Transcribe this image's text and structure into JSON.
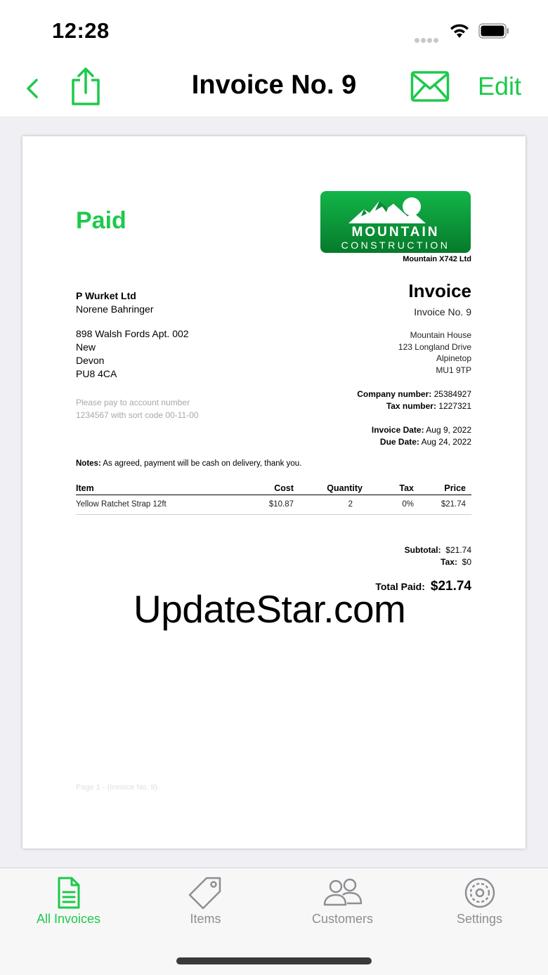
{
  "status": {
    "time": "12:28"
  },
  "nav": {
    "title": "Invoice No. 9",
    "edit_label": "Edit"
  },
  "colors": {
    "accent": "#1ec94c",
    "logo_green": "#0a9a3a",
    "tab_inactive": "#8e8e93"
  },
  "invoice": {
    "status": "Paid",
    "logo_line1": "MOUNTAIN",
    "logo_line2": "CONSTRUCTION",
    "company": "Mountain X742 Ltd",
    "heading": "Invoice",
    "number": "Invoice No. 9",
    "customer_company": "P Wurket Ltd",
    "customer_contact": "Norene Bahringer",
    "customer_address": [
      "898 Walsh Fords Apt. 002",
      "New",
      "Devon",
      "PU8 4CA"
    ],
    "payment_note": [
      "Please pay to account number",
      "1234567 with sort code 00-11-00"
    ],
    "from_address": [
      "Mountain House",
      "123 Longland Drive",
      "Alpinetop",
      "MU1 9TP"
    ],
    "company_number_label": "Company number:",
    "company_number": "25384927",
    "tax_number_label": "Tax number:",
    "tax_number": "1227321",
    "invoice_date_label": "Invoice Date:",
    "invoice_date": "Aug 9, 2022",
    "due_date_label": "Due Date:",
    "due_date": "Aug 24, 2022",
    "notes_label": "Notes:",
    "notes": "As agreed, payment will be cash on delivery, thank you.",
    "columns": [
      "Item",
      "Cost",
      "Quantity",
      "Tax",
      "Price"
    ],
    "items": [
      {
        "item": "Yellow Ratchet Strap 12ft",
        "cost": "$10.87",
        "quantity": "2",
        "tax": "0%",
        "price": "$21.74"
      }
    ],
    "subtotal_label": "Subtotal:",
    "subtotal": "$21.74",
    "tax_label": "Tax:",
    "tax": "$0",
    "total_label": "Total Paid:",
    "total": "$21.74",
    "page_footer": "Page 1 - (Invoice No. 9)"
  },
  "watermark": "UpdateStar.com",
  "tabs": [
    {
      "label": "All Invoices",
      "icon": "document-icon",
      "active": true
    },
    {
      "label": "Items",
      "icon": "tag-icon",
      "active": false
    },
    {
      "label": "Customers",
      "icon": "people-icon",
      "active": false
    },
    {
      "label": "Settings",
      "icon": "gear-icon",
      "active": false
    }
  ]
}
